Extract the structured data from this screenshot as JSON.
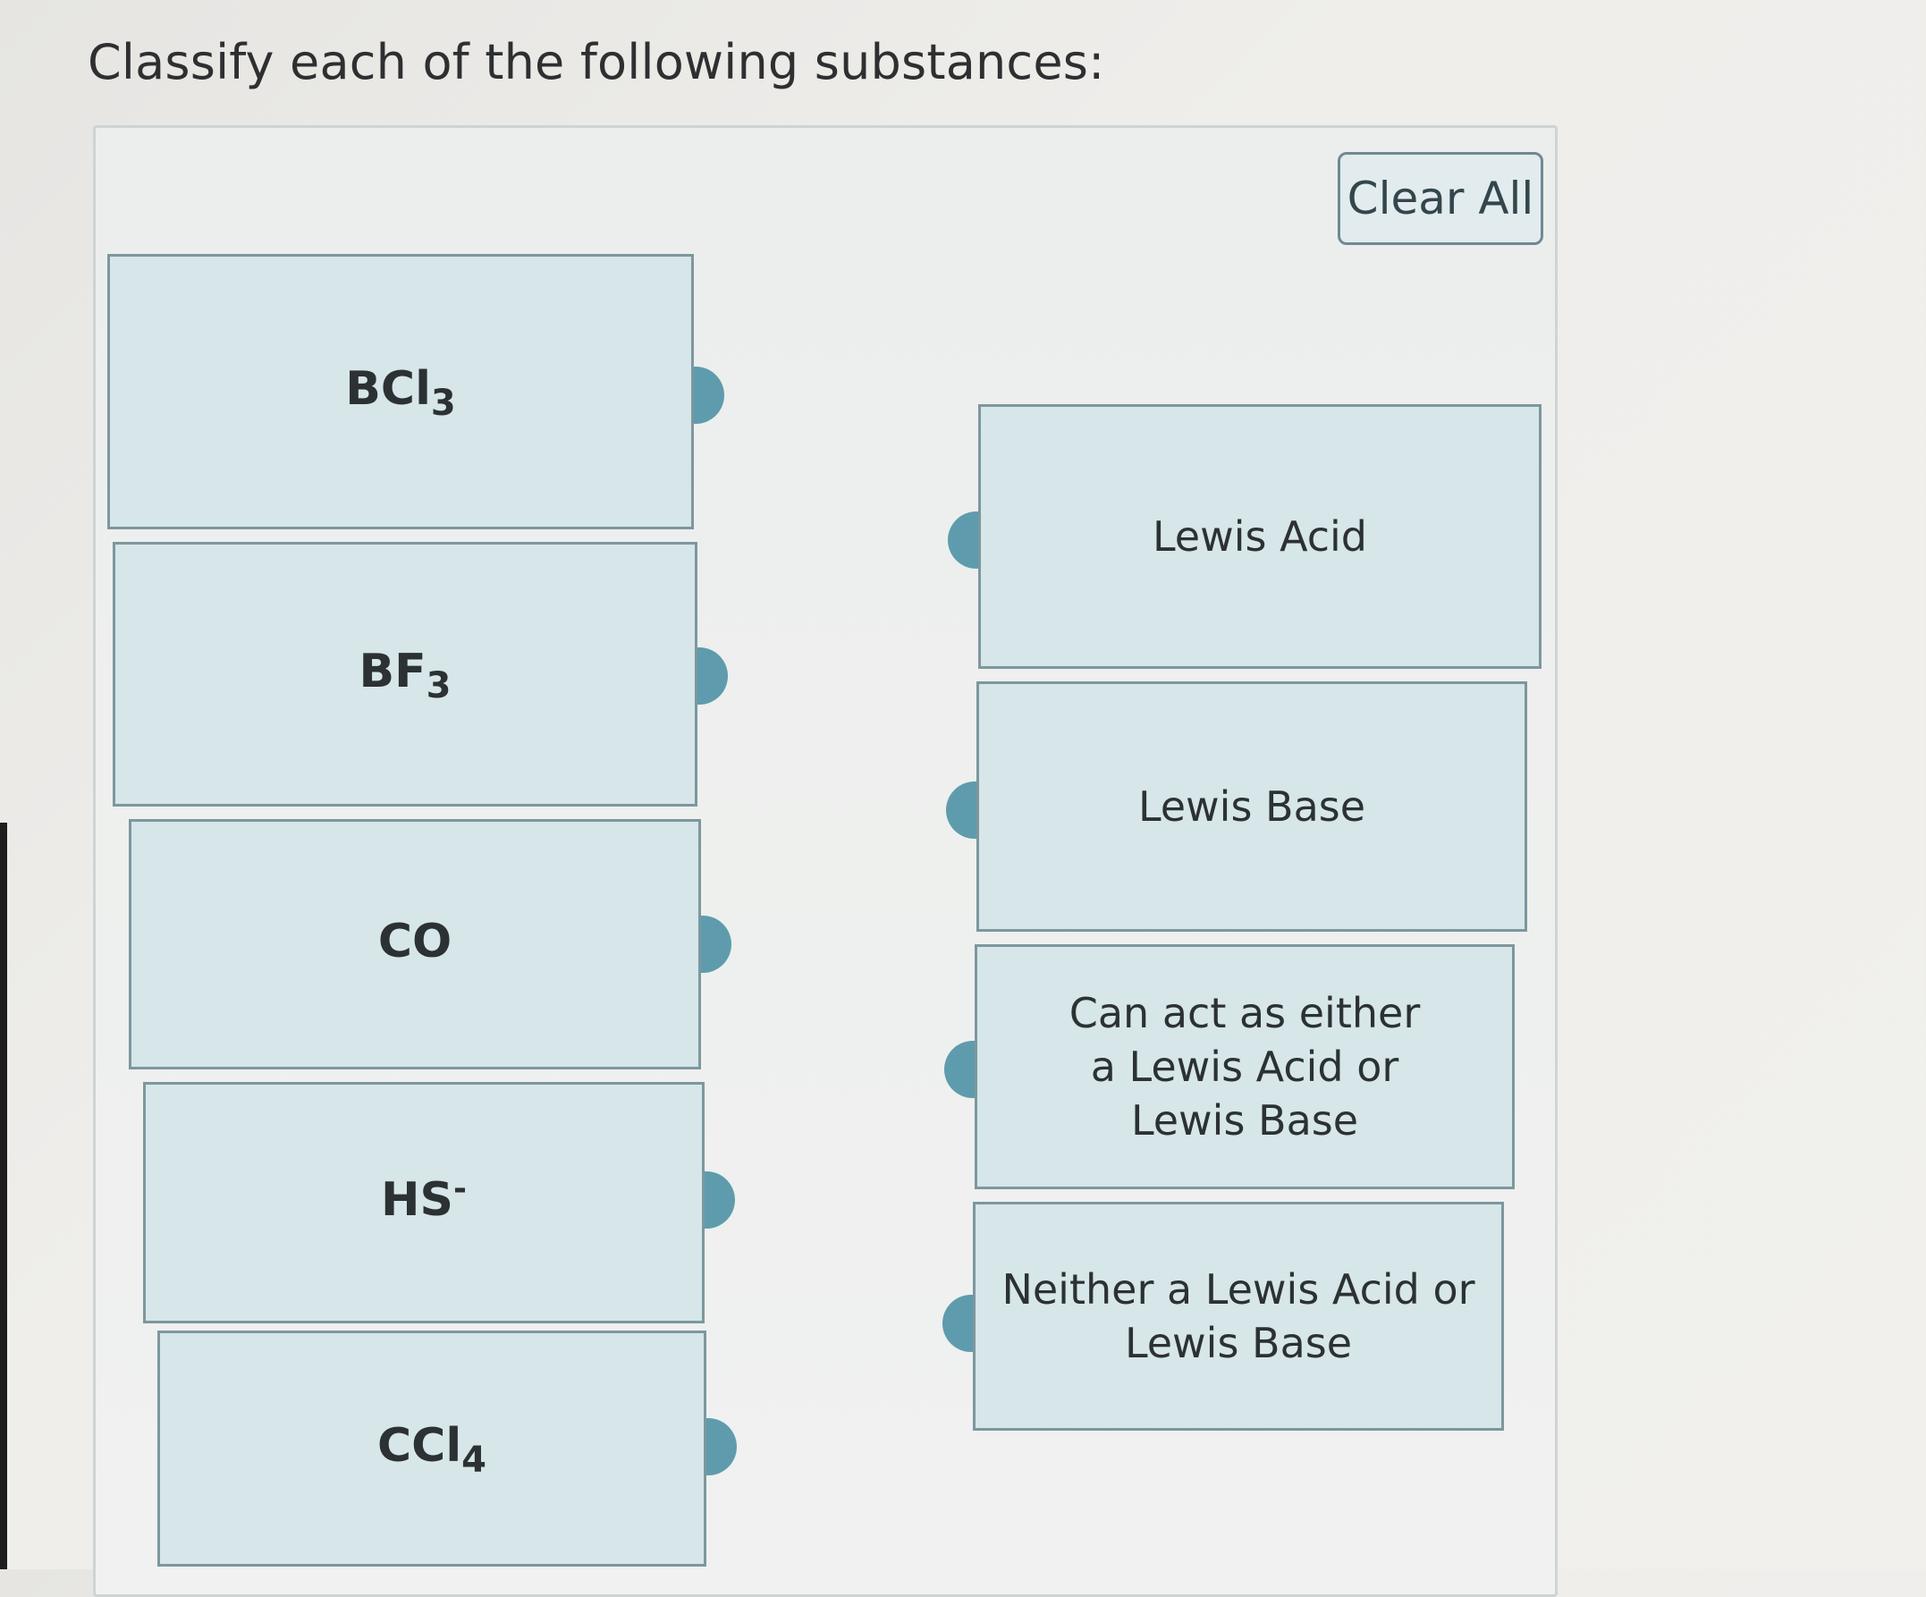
{
  "question": {
    "prompt": "Classify each of the following substances:"
  },
  "toolbar": {
    "clear_all_label": "Clear All"
  },
  "substances": [
    {
      "base": "BCl",
      "sub": "3",
      "sup": ""
    },
    {
      "base": "BF",
      "sub": "3",
      "sup": ""
    },
    {
      "base": "CO",
      "sub": "",
      "sup": ""
    },
    {
      "base": "HS",
      "sub": "",
      "sup": "-"
    },
    {
      "base": "CCl",
      "sub": "4",
      "sup": ""
    }
  ],
  "categories": [
    {
      "label": "Lewis Acid"
    },
    {
      "label": "Lewis Base"
    },
    {
      "label": "Can act as either a Lewis Acid or Lewis Base"
    },
    {
      "label": "Neither a Lewis Acid or Lewis Base"
    }
  ],
  "colors": {
    "card_fill": "#d6e6e9",
    "card_border": "#7d979e",
    "connector_tab": "#5e9cad"
  }
}
